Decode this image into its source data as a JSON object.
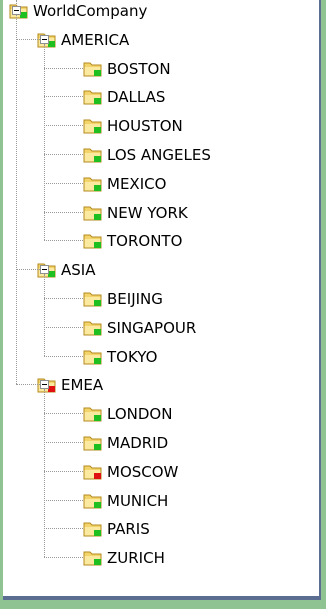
{
  "tree": {
    "root": {
      "label": "WorldCompany",
      "status": "green",
      "expanded": true
    },
    "groups": [
      {
        "label": "AMERICA",
        "status": "green",
        "expanded": true,
        "children": [
          {
            "label": "BOSTON",
            "status": "green"
          },
          {
            "label": "DALLAS",
            "status": "green"
          },
          {
            "label": "HOUSTON",
            "status": "green"
          },
          {
            "label": "LOS ANGELES",
            "status": "green"
          },
          {
            "label": "MEXICO",
            "status": "green"
          },
          {
            "label": "NEW YORK",
            "status": "green"
          },
          {
            "label": "TORONTO",
            "status": "green"
          }
        ]
      },
      {
        "label": "ASIA",
        "status": "green",
        "expanded": true,
        "children": [
          {
            "label": "BEIJING",
            "status": "green"
          },
          {
            "label": "SINGAPOUR",
            "status": "green"
          },
          {
            "label": "TOKYO",
            "status": "green"
          }
        ]
      },
      {
        "label": "EMEA",
        "status": "red",
        "expanded": true,
        "children": [
          {
            "label": "LONDON",
            "status": "green"
          },
          {
            "label": "MADRID",
            "status": "green"
          },
          {
            "label": "MOSCOW",
            "status": "red"
          },
          {
            "label": "MUNICH",
            "status": "green"
          },
          {
            "label": "PARIS",
            "status": "green"
          },
          {
            "label": "ZURICH",
            "status": "green"
          }
        ]
      }
    ]
  },
  "colors": {
    "status_green": "#1fbf1f",
    "status_red": "#e01010",
    "folder_fill": "#f3d46b",
    "folder_edge": "#b48a1c",
    "background": "#8fc391",
    "frame_border": "#5b6e92"
  },
  "icons": {
    "folder": "folder-icon",
    "expander": "collapse-toggle-icon"
  }
}
